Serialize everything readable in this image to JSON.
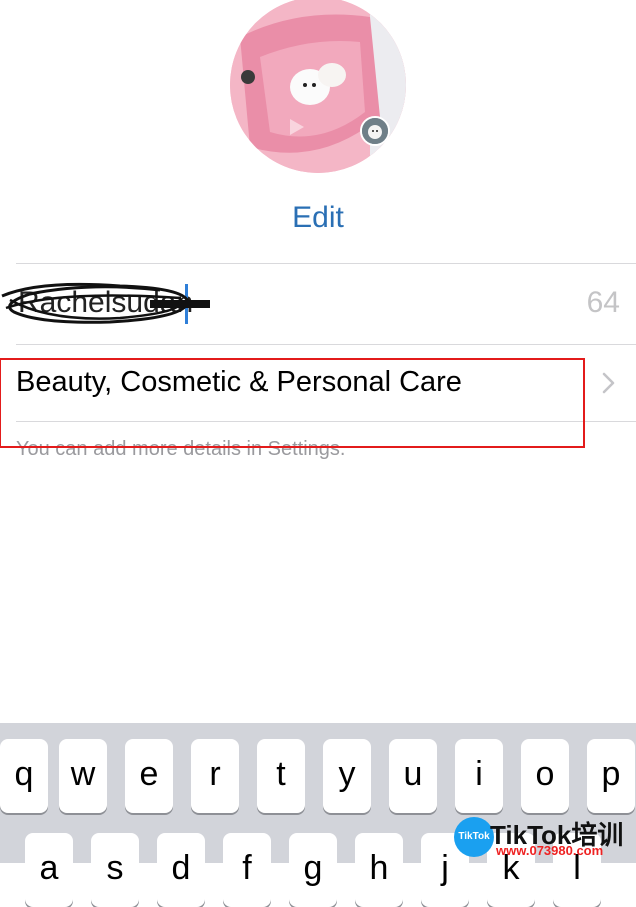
{
  "profile": {
    "edit_label": "Edit",
    "name_value": "Rachelsudan",
    "name_remaining": "64",
    "category_label": "Beauty, Cosmetic & Personal Care",
    "hint_text": "You can add more details in Settings."
  },
  "keyboard": {
    "row1": [
      "q",
      "w",
      "e",
      "r",
      "t",
      "y",
      "u",
      "i",
      "o",
      "p"
    ],
    "row2": [
      "a",
      "s",
      "d",
      "f",
      "g",
      "h",
      "j",
      "k",
      "l"
    ]
  },
  "watermark": {
    "logo_text": "TikTok",
    "title": "TikTok培训",
    "url": "www.073980.com"
  },
  "colors": {
    "accent": "#2a6fb4",
    "highlight": "#e31b1b",
    "keyboard_bg": "#d2d4da"
  }
}
